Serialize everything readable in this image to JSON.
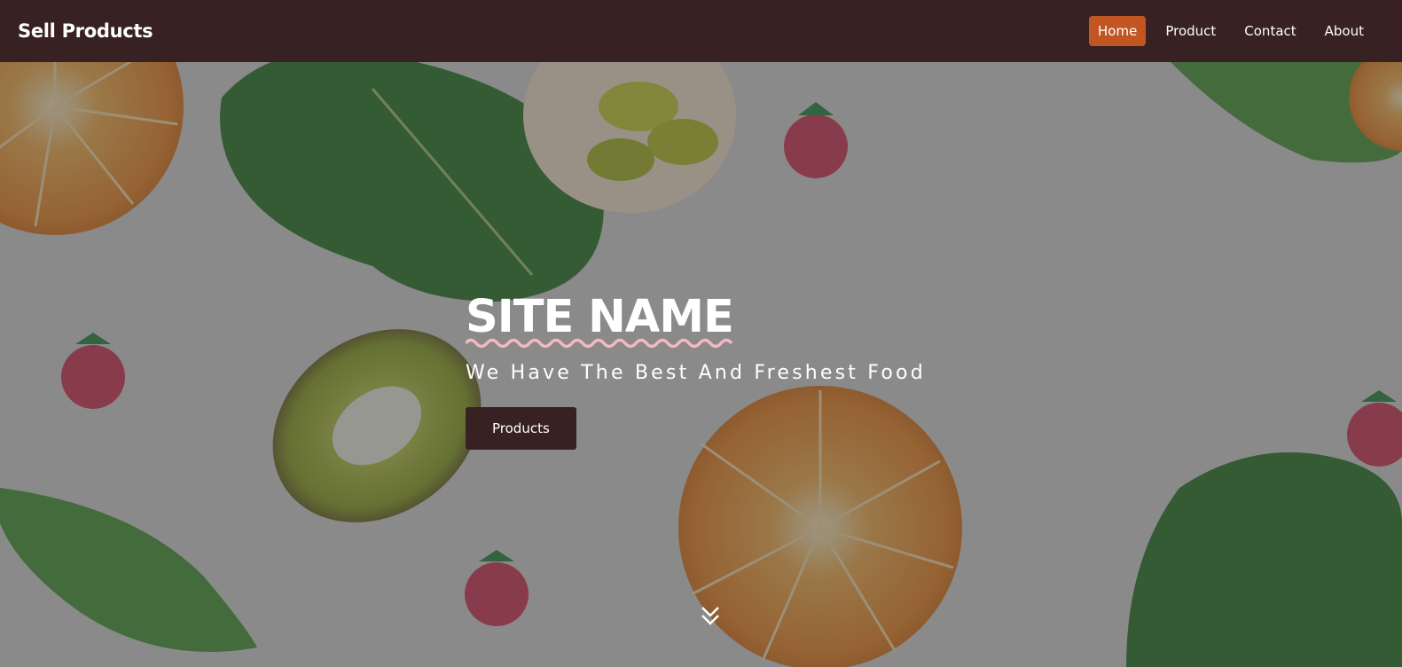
{
  "navbar": {
    "brand": "Sell Products",
    "links": [
      {
        "label": "Home",
        "active": true
      },
      {
        "label": "Product",
        "active": false
      },
      {
        "label": "Contact",
        "active": false
      },
      {
        "label": "About",
        "active": false
      }
    ]
  },
  "hero": {
    "title": "SITE NAME",
    "tagline": "We Have The Best And Freshest Food",
    "cta_label": "Products",
    "scroll_icon": "chevrons-down-icon"
  },
  "colors": {
    "navbar_bg": "#372122",
    "active_link": "#c25623",
    "underline_wave": "#f4b8c3",
    "button_bg": "#372122"
  }
}
